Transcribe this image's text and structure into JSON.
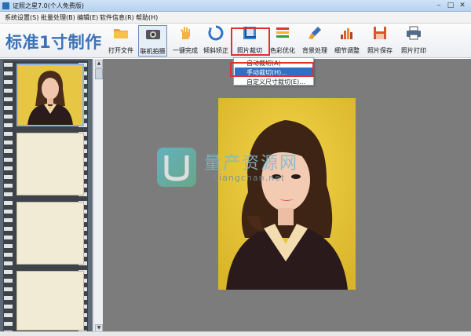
{
  "window": {
    "title": "证照之星7.0(个人免费版)",
    "minimize": "–",
    "maximize": "□",
    "close": "✕"
  },
  "menu": [
    {
      "label": "系统设置(S)"
    },
    {
      "label": "批量处理(B)"
    },
    {
      "label": "编辑(E)"
    },
    {
      "label": "软件信息(R)"
    },
    {
      "label": "帮助(H)"
    }
  ],
  "brand": "标准1寸制作",
  "toolbar": [
    {
      "label": "打开文件",
      "icon": "folder-icon"
    },
    {
      "label": "联机拍摄",
      "icon": "camera-icon"
    },
    {
      "label": "一键完成",
      "icon": "hand-icon"
    },
    {
      "label": "倾斜矫正",
      "icon": "rotate-icon"
    },
    {
      "label": "照片裁切",
      "icon": "crop-icon"
    },
    {
      "label": "色彩优化",
      "icon": "palette-icon"
    },
    {
      "label": "背景处理",
      "icon": "brush-icon"
    },
    {
      "label": "细节调整",
      "icon": "levels-icon"
    },
    {
      "label": "照片保存",
      "icon": "save-icon"
    },
    {
      "label": "照片打印",
      "icon": "printer-icon"
    }
  ],
  "crop_menu": [
    {
      "label": "自动裁切(A)"
    },
    {
      "label": "手动裁切(H)..."
    },
    {
      "label": "自定义尺寸裁切(E)..."
    }
  ],
  "watermark": {
    "cn": "量产资源网",
    "en": "Liangchan.net"
  },
  "colors": {
    "brand": "#3c73b6",
    "highlight": "#e03030",
    "selection": "#2f6fc6",
    "canvas": "#7c7c7c",
    "photo_bg": "#e4c73a"
  }
}
